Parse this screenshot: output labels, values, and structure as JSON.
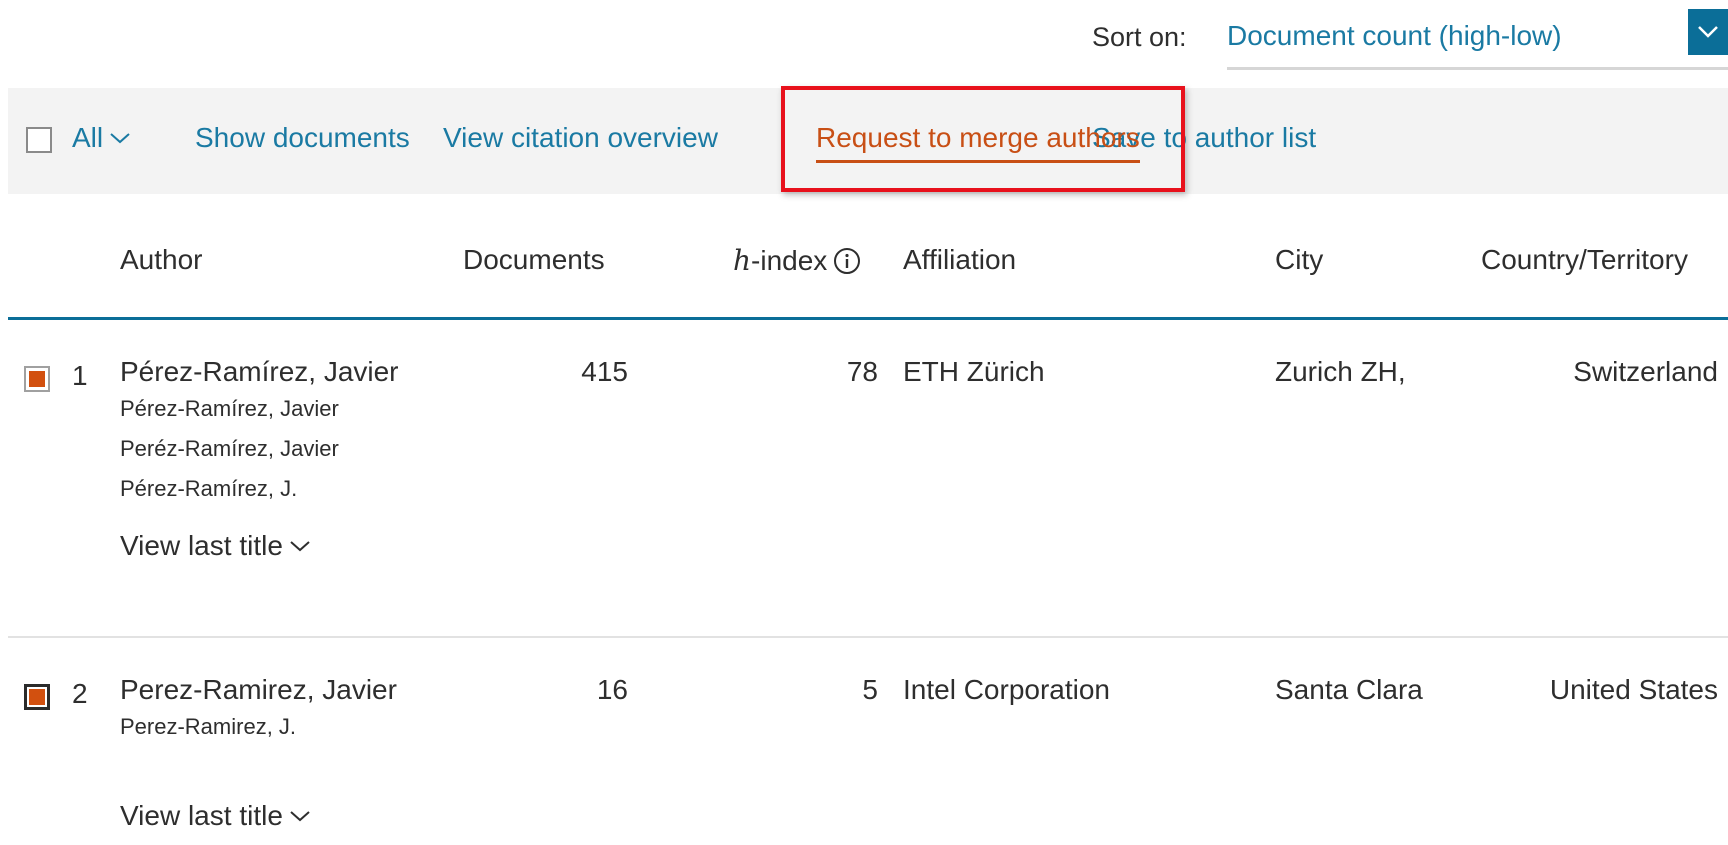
{
  "sort": {
    "label": "Sort on:",
    "value": "Document count (high-low)"
  },
  "toolbar": {
    "all_label": "All",
    "show_documents": "Show documents",
    "view_citation_overview": "View citation overview",
    "request_merge": "Request to merge authors",
    "save_to_list": "Save to author list"
  },
  "table": {
    "headers": {
      "author": "Author",
      "documents": "Documents",
      "h_prefix": "h",
      "h_suffix": "-index",
      "affiliation": "Affiliation",
      "city": "City",
      "country": "Country/Territory"
    },
    "rows": [
      {
        "num": "1",
        "name": "Pérez-Ramírez, Javier",
        "variants": [
          "Pérez-Ramírez, Javier",
          "Peréz-Ramírez, Javier",
          "Pérez-Ramírez, J."
        ],
        "documents": "415",
        "h_index": "78",
        "affiliation": "ETH Zürich",
        "city": "Zurich ZH,",
        "country": "Switzerland",
        "view_last": "View last title"
      },
      {
        "num": "2",
        "name": "Perez-Ramirez, Javier",
        "variants": [
          "Perez-Ramirez, J."
        ],
        "documents": "16",
        "h_index": "5",
        "affiliation": "Intel Corporation",
        "city": "Santa Clara",
        "country": "United States",
        "view_last": "View last title"
      }
    ]
  },
  "colors": {
    "link": "#1a7aa3",
    "accent_orange": "#c84f15",
    "highlight_red": "#e8111c",
    "header_rule": "#0b6e98"
  }
}
